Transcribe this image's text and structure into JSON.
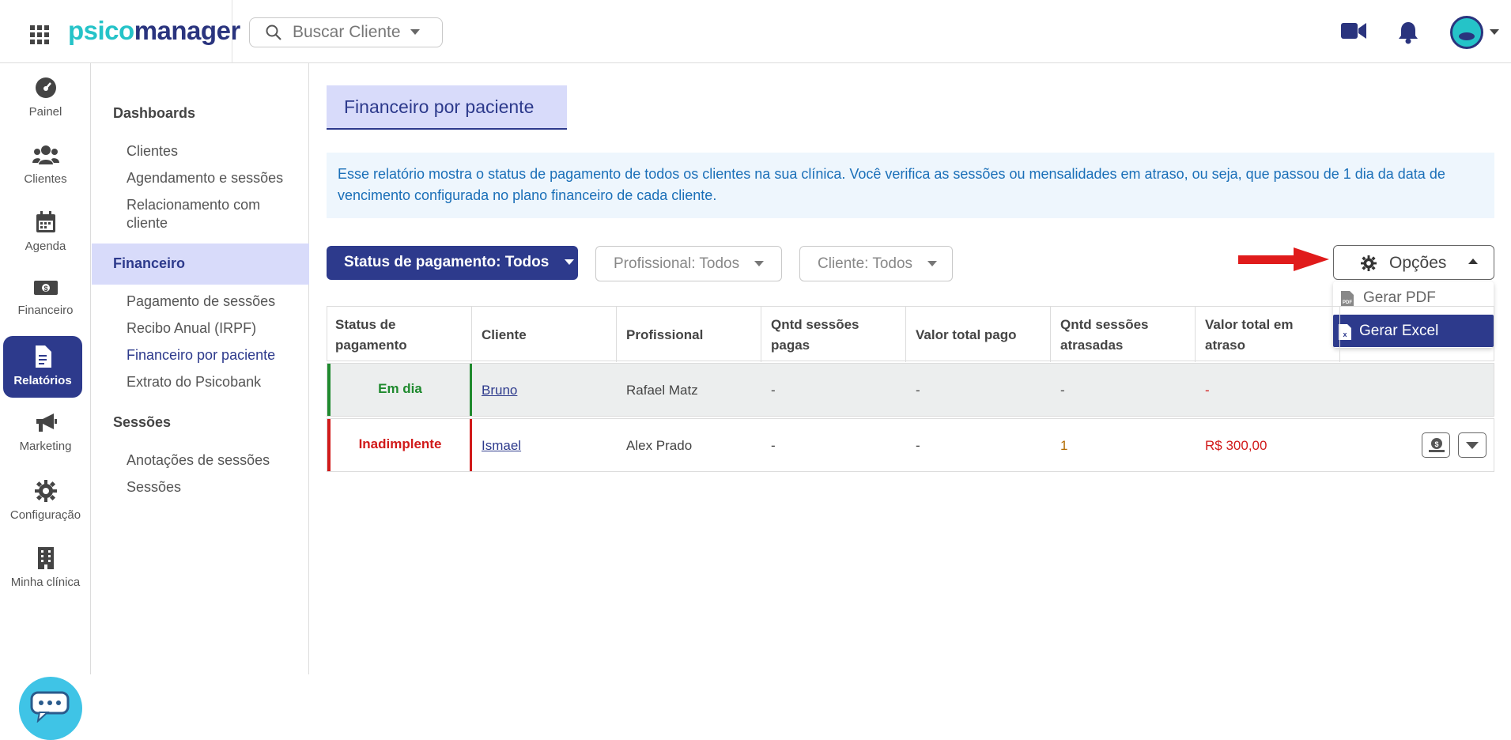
{
  "logo": {
    "part1": "psico",
    "part2": "manager"
  },
  "search": {
    "placeholder": "Buscar Cliente"
  },
  "leftnav": [
    {
      "label": "Painel",
      "icon": "gauge-icon"
    },
    {
      "label": "Clientes",
      "icon": "users-icon"
    },
    {
      "label": "Agenda",
      "icon": "calendar-icon"
    },
    {
      "label": "Financeiro",
      "icon": "money-icon"
    },
    {
      "label": "Relatórios",
      "icon": "report-icon",
      "active": true
    },
    {
      "label": "Marketing",
      "icon": "megaphone-icon"
    },
    {
      "label": "Configuração",
      "icon": "gear-icon"
    },
    {
      "label": "Minha clínica",
      "icon": "building-icon"
    }
  ],
  "submenu": {
    "dashboards": "Dashboards",
    "dash_items": [
      "Clientes",
      "Agendamento e sessões",
      "Relacionamento com cliente"
    ],
    "financeiro": "Financeiro",
    "fin_items": [
      "Pagamento de sessões",
      "Recibo Anual (IRPF)",
      "Financeiro por paciente",
      "Extrato do Psicobank"
    ],
    "sessoes": "Sessões",
    "ses_items": [
      "Anotações de sessões",
      "Sessões"
    ]
  },
  "page": {
    "title": "Financeiro por paciente",
    "info": "Esse relatório mostra o status de pagamento de todos os clientes na sua clínica. Você verifica as sessões ou mensalidades em atraso, ou seja, que passou de 1 dia da data de vencimento configurada no plano financeiro de cada cliente."
  },
  "filters": {
    "status": "Status de pagamento: Todos",
    "profissional": "Profissional: Todos",
    "cliente": "Cliente: Todos"
  },
  "options": {
    "label": "Opções",
    "items": [
      "Gerar PDF",
      "Gerar Excel"
    ]
  },
  "table": {
    "headers": [
      "Status de pagamento",
      "Cliente",
      "Profissional",
      "Qntd sessões pagas",
      "Valor total pago",
      "Qntd sessões atrasadas",
      "Valor total em atraso"
    ],
    "rows": [
      {
        "status": "Em dia",
        "cliente": "Bruno",
        "profissional": "Rafael Matz",
        "pagas": "-",
        "valor_pago": "-",
        "atrasadas": "-",
        "valor_atraso": "-"
      },
      {
        "status": "Inadimplente",
        "cliente": "Ismael",
        "profissional": "Alex Prado",
        "pagas": "-",
        "valor_pago": "-",
        "atrasadas": "1",
        "valor_atraso": "R$ 300,00"
      }
    ]
  },
  "colors": {
    "primary": "#2d3a8c",
    "accent": "#25c3c8",
    "ok": "#1f8a2e",
    "late": "#d11a1a"
  }
}
